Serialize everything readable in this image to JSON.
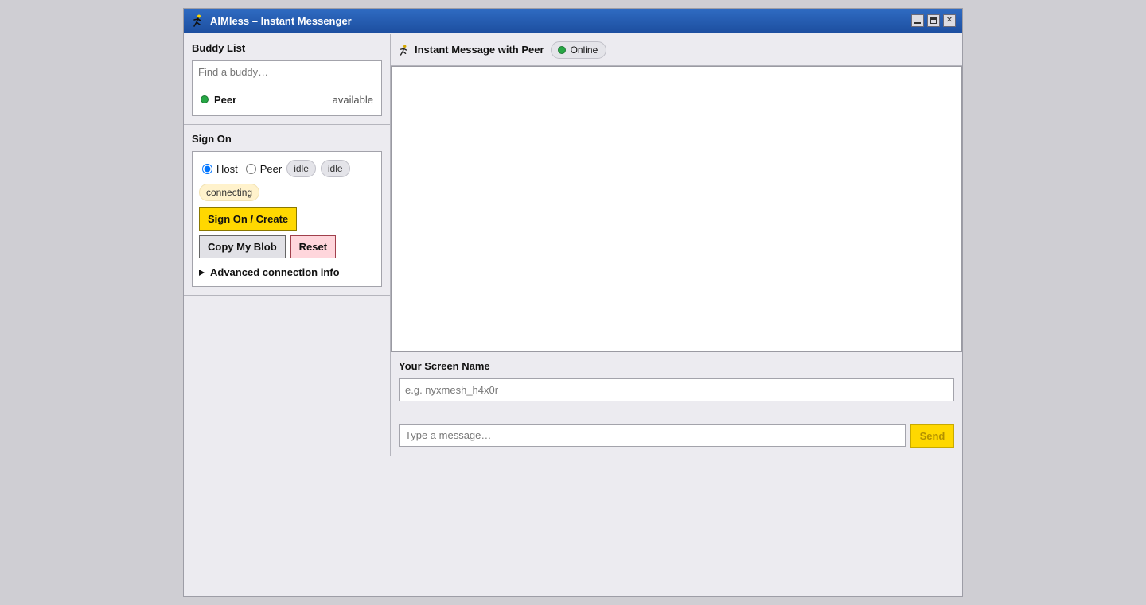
{
  "window": {
    "title": "AIMless – Instant Messenger",
    "buttons": [
      "minimize",
      "maximize",
      "close"
    ]
  },
  "buddy_list": {
    "heading": "Buddy List",
    "search_placeholder": "Find a buddy…",
    "buddies": [
      {
        "name": "Peer",
        "status": "available",
        "status_color": "#27a745"
      }
    ]
  },
  "sign_on": {
    "heading": "Sign On",
    "role_options": [
      "Host",
      "Peer"
    ],
    "selected_role": "Host",
    "status_pills": [
      "idle",
      "idle",
      "connecting"
    ],
    "sign_on_button": "Sign On / Create",
    "copy_blob_button": "Copy My Blob",
    "reset_button": "Reset",
    "advanced_label": "Advanced connection info"
  },
  "chat": {
    "header_title": "Instant Message with Peer",
    "presence": "Online",
    "screen_name_label": "Your Screen Name",
    "screen_name_placeholder": "e.g. nyxmesh_h4x0r",
    "message_placeholder": "Type a message…",
    "send_button": "Send"
  },
  "colors": {
    "titlebar": "#1d4fa0",
    "accent_yellow": "#ffd800",
    "online_green": "#27a745",
    "reset_red": "#ffd6dc"
  }
}
